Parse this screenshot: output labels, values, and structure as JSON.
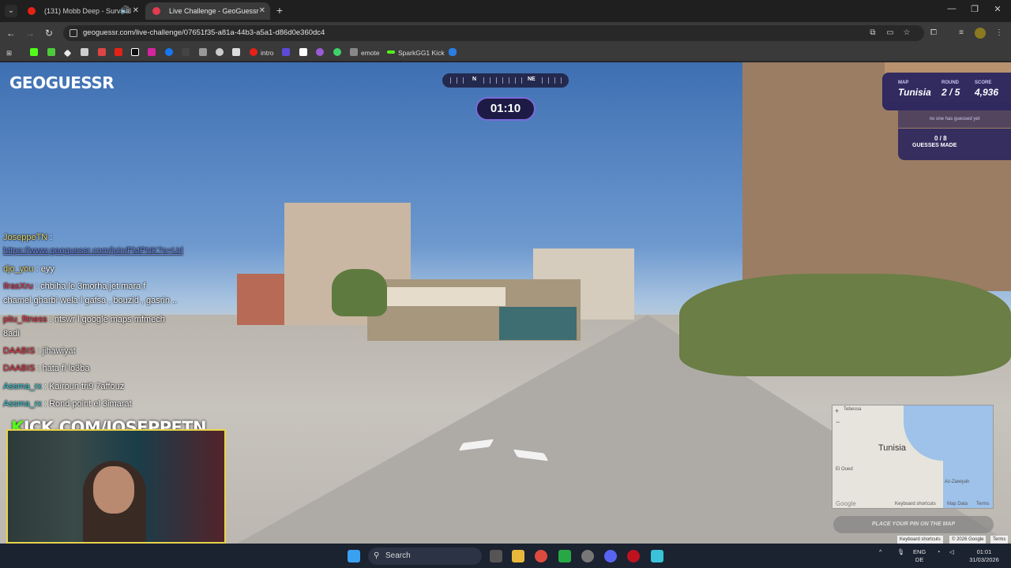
{
  "browser": {
    "tabs": [
      {
        "label": "(131) Mobb Deep - Survival",
        "active": false
      },
      {
        "label": "Live Challenge - GeoGuessr",
        "active": true
      }
    ],
    "url": "geoguessr.com/live-challenge/07651f35-a81a-44b3-a5a1-d86d0e360dc4",
    "bookmarks": [
      "intro",
      "emote",
      "SparkGG1 Kick"
    ]
  },
  "game": {
    "logo": "GEOGUESSR",
    "compass": {
      "n": "N",
      "ne": "NE"
    },
    "timer": "01:10",
    "map_label": "MAP",
    "map_value": "Tunisia",
    "round_label": "ROUND",
    "round_value": "2 / 5",
    "score_label": "SCORE",
    "score_value": "4,936",
    "no_guess_text": "no one has guessed yet",
    "guesses_count": "0 / 8",
    "guesses_label": "GUESSES MADE",
    "place_pin": "PLACE YOUR PIN ON THE MAP",
    "minimap": {
      "country": "Tunisia",
      "city": "Az-Zawiyah",
      "west": "El Oued",
      "north": "Tebessa",
      "keyboard": "Keyboard shortcuts",
      "mapdata": "Map Data",
      "terms": "Terms",
      "google": "Google"
    },
    "footer": {
      "keyboard": "Keyboard shortcuts",
      "copyright": "© 2026 Google",
      "terms": "Terms"
    }
  },
  "chat": {
    "messages": [
      {
        "user": "JoseppeTN",
        "text": " :",
        "color": "#e3d36d"
      },
      {
        "user": "",
        "text": "https://www.geoguessr.com/join/FMPNK?s=Url",
        "color": "#6a80d8"
      },
      {
        "user": "djo_you",
        "text": " : eyy",
        "color": "#e3d36d"
      },
      {
        "user": "IlrasXru",
        "text": " : chbiha le 3morha jet mara f",
        "color": "#e2364a"
      },
      {
        "user": "",
        "text": "chamel gharbi wela l gafsa , bouzid , gasrin ..",
        "color": "#ffffff"
      },
      {
        "user": "pitu_fitness",
        "text": " : ntswr l google maps mfmech",
        "color": "#e2364a"
      },
      {
        "user": "",
        "text": "8adi",
        "color": "#ffffff"
      },
      {
        "user": "DAABIS",
        "text": " : jihawiyat",
        "color": "#e2364a"
      },
      {
        "user": "DAABIS",
        "text": " : hata fl lo3ba",
        "color": "#e2364a"
      },
      {
        "user": "Assma_rx",
        "text": " : Kairoun tri9 7affouz",
        "color": "#38c7d6"
      },
      {
        "user": "Assma_rx",
        "text": " : Rond point el 3imarat",
        "color": "#38c7d6"
      }
    ],
    "banner_k": "K",
    "banner_rest": "ICK.COM/JOSEPPETN"
  },
  "taskbar": {
    "search": "Search",
    "lang": "ENG",
    "lang2": "DE",
    "time": "01:01",
    "date": "31/03/2026"
  },
  "colors": {
    "accent": "#7b6bd9",
    "panel": "#24205e",
    "kick_green": "#53fc18"
  }
}
